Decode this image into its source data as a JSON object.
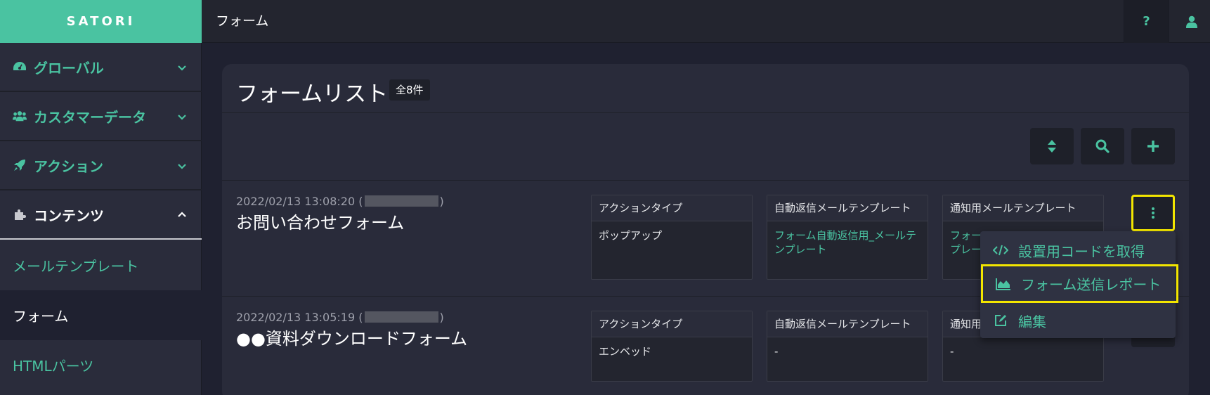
{
  "app": {
    "brand": "SATORI",
    "page_title": "フォーム"
  },
  "topbar": {
    "help_label": "?",
    "help_icon": "question-icon",
    "user_icon": "user-icon"
  },
  "sidebar": {
    "items": [
      {
        "label": "グローバル",
        "icon": "dashboard-icon",
        "state": "collapsed"
      },
      {
        "label": "カスタマーデータ",
        "icon": "users-icon",
        "state": "collapsed"
      },
      {
        "label": "アクション",
        "icon": "rocket-icon",
        "state": "collapsed"
      },
      {
        "label": "コンテンツ",
        "icon": "puzzle-icon",
        "state": "expanded"
      }
    ],
    "sub_items": [
      {
        "label": "メールテンプレート",
        "active": false
      },
      {
        "label": "フォーム",
        "active": true
      },
      {
        "label": "HTMLパーツ",
        "active": false
      }
    ]
  },
  "main": {
    "title": "フォームリスト",
    "count_badge": "全8件",
    "toolbar": {
      "sort_icon": "sort-icon",
      "search_icon": "search-icon",
      "add_icon": "plus-icon"
    },
    "rows": [
      {
        "date": "2022/02/13 13:08:20",
        "name": "お問い合わせフォーム",
        "action_type_header": "アクションタイプ",
        "action_type": "ポップアップ",
        "auto_reply_header": "自動返信メールテンプレート",
        "auto_reply": "フォーム自動返信用_メールテンプレート",
        "notify_header": "通知用メールテンプレート",
        "notify": "フォー\nプレー"
      },
      {
        "date": "2022/02/13 13:05:19",
        "name": "●●資料ダウンロードフォーム",
        "action_type_header": "アクションタイプ",
        "action_type": "エンベッド",
        "auto_reply_header": "自動返信メールテンプレート",
        "auto_reply": "-",
        "notify_header": "通知用",
        "notify": "-"
      }
    ]
  },
  "dropdown": {
    "items": [
      {
        "label": "設置用コードを取得",
        "icon": "code-icon"
      },
      {
        "label": "フォーム送信レポート",
        "icon": "area-chart-icon",
        "highlighted": true
      },
      {
        "label": "編集",
        "icon": "edit-icon"
      }
    ]
  },
  "colors": {
    "accent": "#4ac3a1",
    "highlight": "#f3e600",
    "background": "#1f2130",
    "panel": "#292b3a"
  }
}
